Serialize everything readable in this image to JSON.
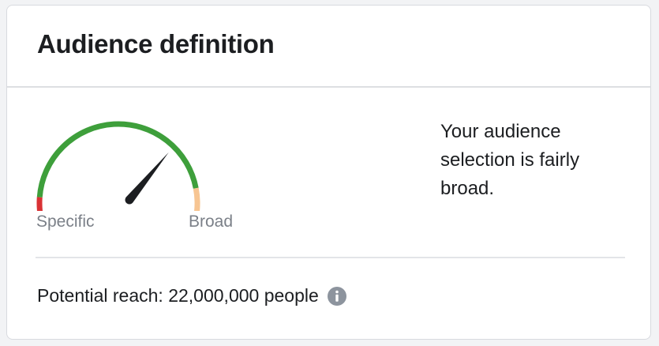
{
  "card": {
    "title": "Audience definition"
  },
  "gauge": {
    "left_label": "Specific",
    "right_label": "Broad",
    "level": 0.72,
    "icon": "speedometer-gauge",
    "colors": {
      "specific": "#d93234",
      "middle": "#3e9f3b",
      "broad": "#f7c592",
      "needle": "#1c1e21"
    }
  },
  "summary": {
    "description": "Your audience selection is fairly broad."
  },
  "reach": {
    "text": "Potential reach: 22,000,000 people",
    "icon": "info-icon"
  }
}
